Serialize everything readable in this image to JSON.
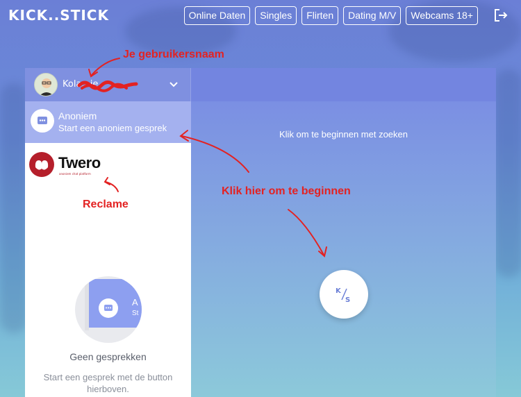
{
  "app": {
    "logo_text": "KICK..STICK"
  },
  "nav": {
    "items": [
      {
        "label": "Online Daten"
      },
      {
        "label": "Singles"
      },
      {
        "label": "Flirten"
      },
      {
        "label": "Dating M/V"
      },
      {
        "label": "Webcams 18+"
      }
    ],
    "logout_icon": "logout-icon"
  },
  "sidebar": {
    "username": "Kola...ie",
    "anonymous": {
      "title": "Anoniem",
      "subtitle": "Start een anoniem gesprek"
    },
    "ad": {
      "brand": "Twero",
      "tagline": "anoniem chat platform"
    },
    "empty_state": {
      "title": "Geen gesprekken",
      "subtitle": "Start een gesprek met de button hierboven.",
      "card_letter_a": "A",
      "card_letter_s": "St"
    }
  },
  "main": {
    "hint": "Klik om te beginnen met zoeken",
    "start_button_icon": "ks-logo-icon"
  },
  "annotations": {
    "username_note": "Je gebruikersnaam",
    "ad_note": "Reclame",
    "start_note": "Klik hier om te beginnen"
  },
  "colors": {
    "accent": "#7385e0",
    "selected_row": "#a4b1ef",
    "annotation": "#e32222",
    "ad_brand": "#b51f2b"
  }
}
